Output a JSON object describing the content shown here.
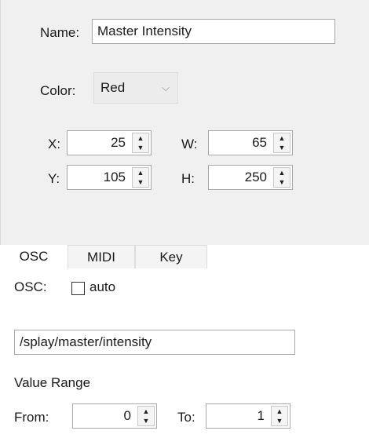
{
  "name": {
    "label": "Name:",
    "value": "Master Intensity"
  },
  "color": {
    "label": "Color:",
    "value": "Red",
    "chevron": "⌵"
  },
  "geometry": {
    "x": {
      "label": "X:",
      "value": "25"
    },
    "y": {
      "label": "Y:",
      "value": "105"
    },
    "w": {
      "label": "W:",
      "value": "65"
    },
    "h": {
      "label": "H:",
      "value": "250"
    }
  },
  "tabs": [
    {
      "label": "OSC",
      "active": true
    },
    {
      "label": "MIDI",
      "active": false
    },
    {
      "label": "Key",
      "active": false
    }
  ],
  "osc": {
    "label": "OSC:",
    "auto_label": "auto",
    "auto_checked": false,
    "address": "/splay/master/intensity",
    "value_range_label": "Value Range",
    "from": {
      "label": "From:",
      "value": "0"
    },
    "to": {
      "label": "To:",
      "value": "1"
    }
  },
  "spin_glyphs": {
    "up": "▲",
    "down": "▼"
  }
}
